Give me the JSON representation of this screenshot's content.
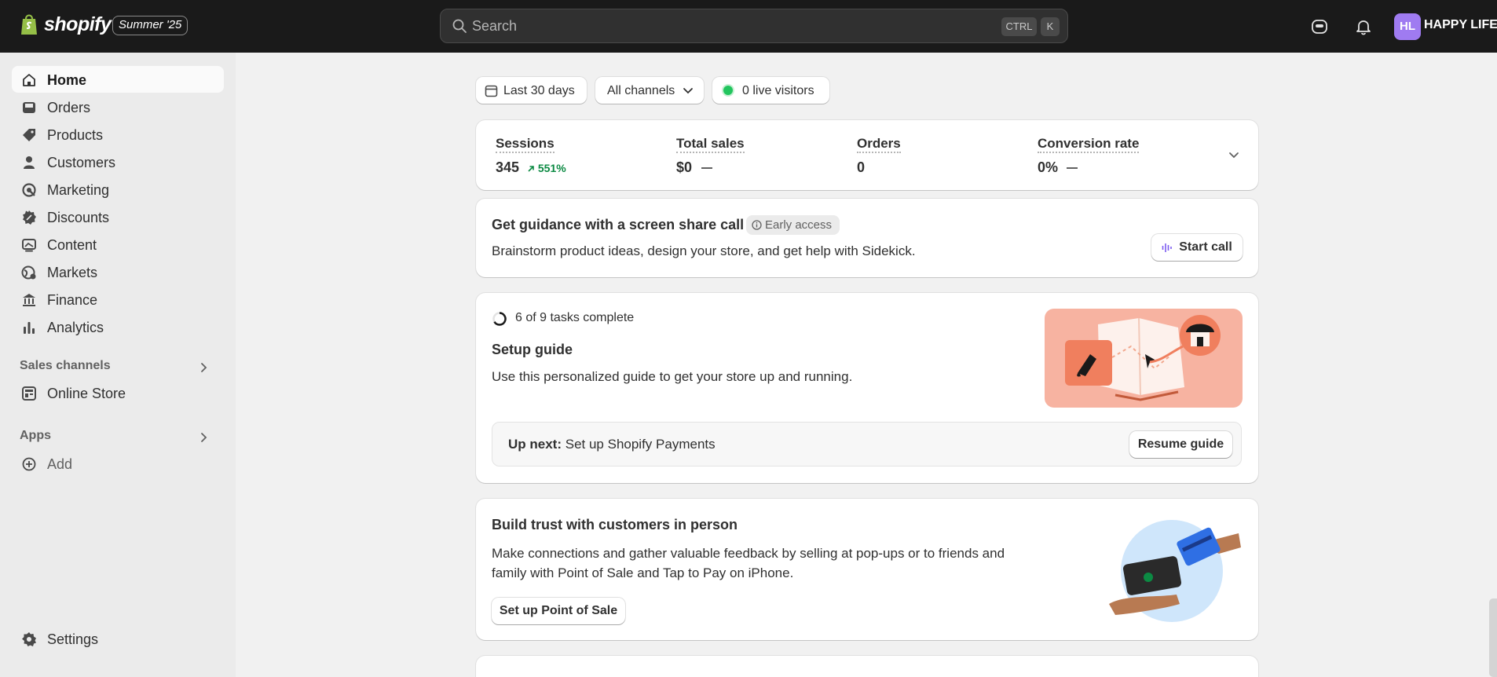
{
  "topbar": {
    "brand": "shopify",
    "edition": "Summer '25",
    "search_placeholder": "Search",
    "shortcut_ctrl": "CTRL",
    "shortcut_key": "K",
    "avatar_initials": "HL",
    "store_name": "HAPPY LIFE"
  },
  "sidebar": {
    "items": [
      {
        "label": "Home",
        "icon": "home-icon",
        "active": true
      },
      {
        "label": "Orders",
        "icon": "inbox-icon"
      },
      {
        "label": "Products",
        "icon": "tag-icon"
      },
      {
        "label": "Customers",
        "icon": "person-icon"
      },
      {
        "label": "Marketing",
        "icon": "target-icon"
      },
      {
        "label": "Discounts",
        "icon": "discount-icon"
      },
      {
        "label": "Content",
        "icon": "image-icon"
      },
      {
        "label": "Markets",
        "icon": "globe-icon"
      },
      {
        "label": "Finance",
        "icon": "bank-icon"
      },
      {
        "label": "Analytics",
        "icon": "bar-chart-icon"
      }
    ],
    "sales_channels_title": "Sales channels",
    "online_store": "Online Store",
    "apps_title": "Apps",
    "add_label": "Add",
    "settings_label": "Settings"
  },
  "filters": {
    "date_range": "Last 30 days",
    "channels": "All channels",
    "live_visitors": "0 live visitors"
  },
  "metrics": [
    {
      "label": "Sessions",
      "value": "345",
      "trend": "551%"
    },
    {
      "label": "Total sales",
      "value": "$0"
    },
    {
      "label": "Orders",
      "value": "0"
    },
    {
      "label": "Conversion rate",
      "value": "0%"
    }
  ],
  "guidance_card": {
    "title": "Get guidance with a screen share call",
    "badge": "Early access",
    "text": "Brainstorm product ideas, design your store, and get help with Sidekick.",
    "button": "Start call"
  },
  "setup_card": {
    "progress_text": "6 of 9 tasks complete",
    "progress_fraction": 0.667,
    "title": "Setup guide",
    "text": "Use this personalized guide to get your store up and running.",
    "up_next_label": "Up next:",
    "up_next_task": "Set up Shopify Payments",
    "button": "Resume guide"
  },
  "pos_card": {
    "title": "Build trust with customers in person",
    "text": "Make connections and gather valuable feedback by selling at pop-ups or to friends and family with Point of Sale and Tap to Pay on iPhone.",
    "button": "Set up Point of Sale"
  },
  "colors": {
    "topbar": "#1a1a1a",
    "sidebar": "#ebebeb",
    "background": "#f1f1f1",
    "accent_green": "#0c8a43",
    "avatar": "#9f7bf1",
    "live_dot": "#22c55e"
  }
}
